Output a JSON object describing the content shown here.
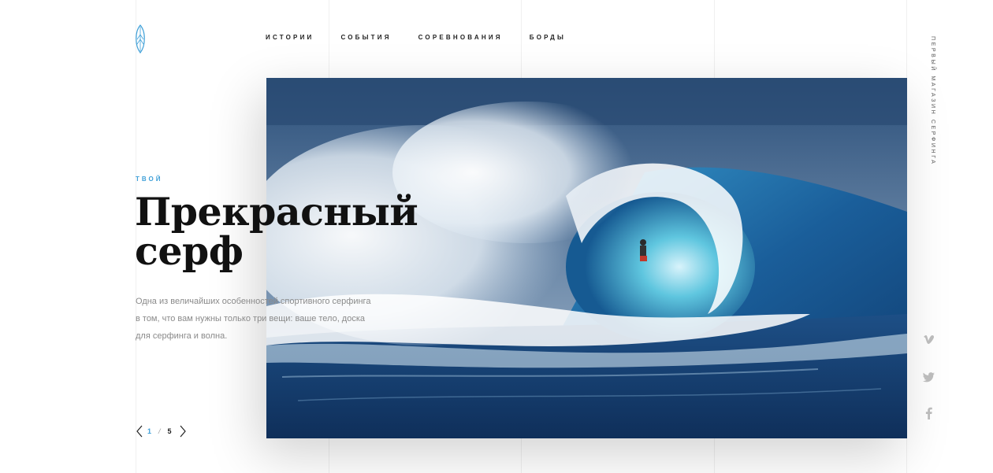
{
  "nav": {
    "items": [
      {
        "label": "ИСТОРИИ"
      },
      {
        "label": "СОБЫТИЯ"
      },
      {
        "label": "СОРЕВНОВАНИЯ"
      },
      {
        "label": "БОРДЫ"
      }
    ]
  },
  "hero": {
    "eyebrow": "ТВОЙ",
    "title_line1": "Прекрасный",
    "title_line2": "серф",
    "description": "Одна из величайших особенностей спортивного серфинга в том, что вам нужны только три вещи: ваше тело, доска для серфинга и волна."
  },
  "pager": {
    "current": "1",
    "separator": "/",
    "total": "5",
    "prev_icon": "chevron-left-icon",
    "next_icon": "chevron-right-icon"
  },
  "side_text": "ПЕРВЫЙ МАГАЗИН СЕРФИНГА",
  "social": [
    {
      "icon": "vimeo-icon"
    },
    {
      "icon": "twitter-icon"
    },
    {
      "icon": "facebook-icon"
    }
  ],
  "colors": {
    "accent": "#3fa0d8",
    "text": "#111111",
    "muted": "#8a8a8a",
    "grid": "#f0f0f0"
  }
}
